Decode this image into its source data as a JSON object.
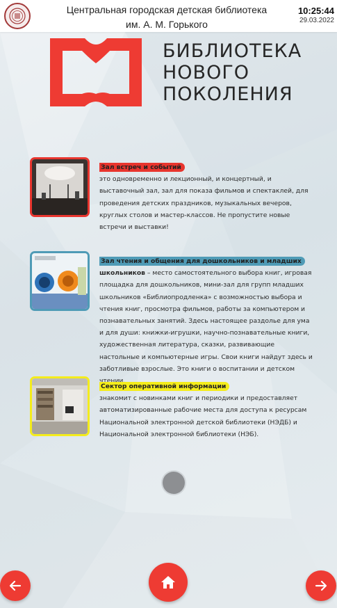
{
  "header": {
    "title_line1": "Центральная городская детская библиотека",
    "title_line2": "им. А. М. Горького",
    "time": "10:25:44",
    "date": "29.03.2022"
  },
  "brand": {
    "line1": "БИБЛИОТЕКА",
    "line2": "НОВОГО",
    "line3": "ПОКОЛЕНИЯ",
    "color": "#ee3b33"
  },
  "sections": [
    {
      "heading": "Зал встреч и событий",
      "text": "это одновременно и лекционный, и концертный, и выставочный зал, зал для показа фильмов и спектаклей, для проведения детских праздников, музыкальных вечеров, круглых столов и мастер-классов. Не пропустите новые встречи и выставки!",
      "accent": "#e8352e"
    },
    {
      "heading": "Зал чтения и общения для дошкольников и младших",
      "heading_tail": "школьников",
      "text": " – место самостоятельного выбора книг, игровая площадка для дошкольников, мини-зал для групп младших школьников «Библиопродленка» с возможностью выбора и чтения книг, просмотра фильмов, работы за компьютером и познавательных занятий. Здесь настоящее раздолье для ума и для души: книжки-игрушки, научно-познавательные книги, художественная литература, сказки, развивающие настольные и компьютерные игры. Свои книги найдут здесь и заботливые взрослые. Это книги о воспитании и детском чтении.",
      "accent": "#4f9bb6"
    },
    {
      "heading": "Сектор оперативной информации",
      "text": "знакомит с новинками книг и периодики и предоставляет автоматизированные рабочие места для доступа к ресурсам Национальной электронной детской библиотеки (НЭДБ) и Национальной электронной библиотеки (НЭБ).",
      "accent": "#f4ec1b"
    }
  ],
  "nav": {
    "prev_icon": "arrow-left-icon",
    "home_icon": "home-icon",
    "next_icon": "arrow-right-icon",
    "color": "#ee3b33"
  }
}
